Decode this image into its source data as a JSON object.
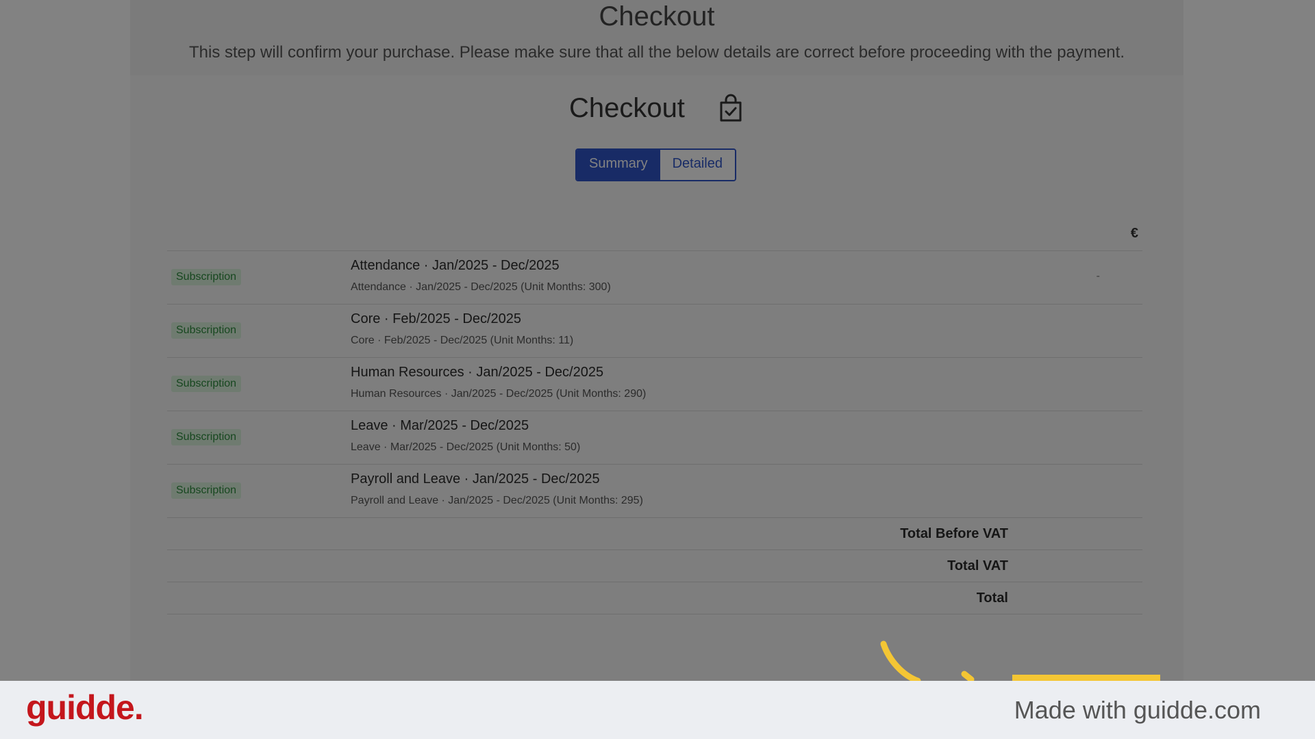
{
  "header": {
    "title": "Checkout",
    "description": "This step will confirm your purchase. Please make sure that all the below details are correct before proceeding with the payment."
  },
  "card": {
    "title": "Checkout",
    "icon": "shopping-bag-check-icon"
  },
  "view_toggle": {
    "options": [
      "Summary",
      "Detailed"
    ],
    "selected": "Summary"
  },
  "table": {
    "currency": "€",
    "rows": [
      {
        "badge": "Subscription",
        "title": "Attendance · Jan/2025 - Dec/2025",
        "detail": "Attendance · Jan/2025 - Dec/2025 (Unit Months: 300)",
        "amount": "-"
      },
      {
        "badge": "Subscription",
        "title": "Core · Feb/2025 - Dec/2025",
        "detail": "Core · Feb/2025 - Dec/2025 (Unit Months: 11)",
        "amount": ""
      },
      {
        "badge": "Subscription",
        "title": "Human Resources · Jan/2025 - Dec/2025",
        "detail": "Human Resources · Jan/2025 - Dec/2025 (Unit Months: 290)",
        "amount": ""
      },
      {
        "badge": "Subscription",
        "title": "Leave · Mar/2025 - Dec/2025",
        "detail": "Leave · Mar/2025 - Dec/2025 (Unit Months: 50)",
        "amount": ""
      },
      {
        "badge": "Subscription",
        "title": "Payroll and Leave · Jan/2025 - Dec/2025",
        "detail": "Payroll and Leave · Jan/2025 - Dec/2025 (Unit Months: 295)",
        "amount": ""
      }
    ],
    "totals": [
      "Total Before VAT",
      "Total VAT",
      "Total"
    ]
  },
  "footer": {
    "logo": "guidde.",
    "tagline": "Made with guidde.com"
  },
  "colors": {
    "accent": "#2f55c8",
    "badge_bg": "#d9f2dc",
    "badge_text": "#2e8b3e",
    "highlight": "#f4c634",
    "brand": "#c4161c"
  }
}
